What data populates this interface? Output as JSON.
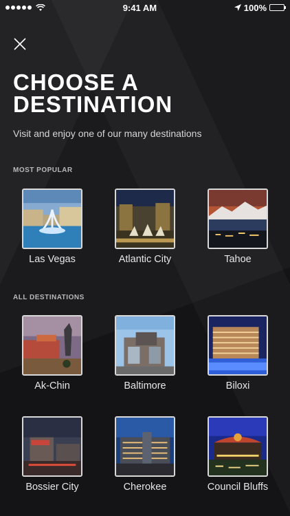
{
  "status_bar": {
    "time": "9:41 AM",
    "battery": "100%",
    "signal_icon": "signal-dots-icon",
    "wifi_icon": "wifi-icon",
    "location_icon": "location-arrow-icon",
    "battery_icon": "battery-icon"
  },
  "header": {
    "close_icon": "close-icon",
    "title": "CHOOSE A DESTINATION",
    "subtitle": "Visit and enjoy one of our many destinations"
  },
  "sections": {
    "most_popular": {
      "label": "MOST POPULAR",
      "items": [
        {
          "label": "Las Vegas"
        },
        {
          "label": "Atlantic City"
        },
        {
          "label": "Tahoe"
        }
      ]
    },
    "all_destinations": {
      "label": "ALL DESTINATIONS",
      "items": [
        {
          "label": "Ak-Chin"
        },
        {
          "label": "Baltimore"
        },
        {
          "label": "Biloxi"
        },
        {
          "label": "Bossier City"
        },
        {
          "label": "Cherokee"
        },
        {
          "label": "Council Bluffs"
        }
      ]
    }
  },
  "colors": {
    "background": "#1b1b1e",
    "text": "#ffffff",
    "muted": "#b9b9bd",
    "thumb_border": "#d9d9d9"
  }
}
